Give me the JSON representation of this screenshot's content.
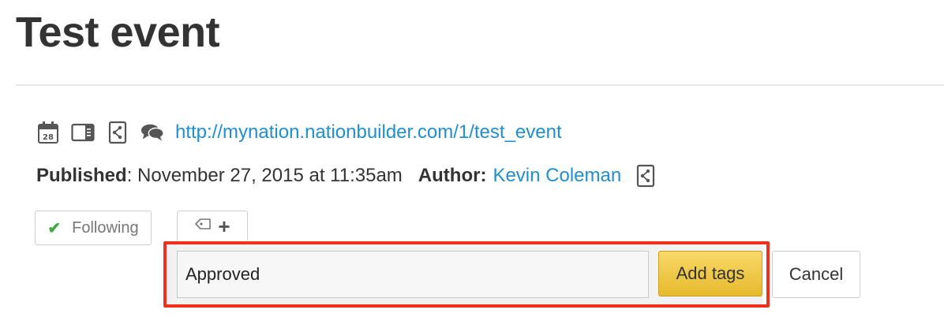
{
  "page": {
    "title": "Test event"
  },
  "links": {
    "event_url": "http://mynation.nationbuilder.com/1/test_event"
  },
  "meta": {
    "published_label": "Published",
    "published_value": ": November 27, 2015 at 11:35am",
    "author_label": "Author:",
    "author_name": "Kevin Coleman"
  },
  "actions": {
    "following_label": "Following",
    "check_glyph": "✔",
    "tag_plus_glyph": "+"
  },
  "tag_form": {
    "input_value": "Approved",
    "add_label": "Add tags",
    "cancel_label": "Cancel"
  },
  "colors": {
    "link": "#1f8fcd",
    "highlight": "#f0301a",
    "add_button": "#f3cd4c",
    "check": "#3fa944"
  },
  "icons": [
    "calendar-icon",
    "sidebar-layout-icon",
    "share-icon",
    "comments-icon",
    "tag-icon",
    "share-icon"
  ]
}
